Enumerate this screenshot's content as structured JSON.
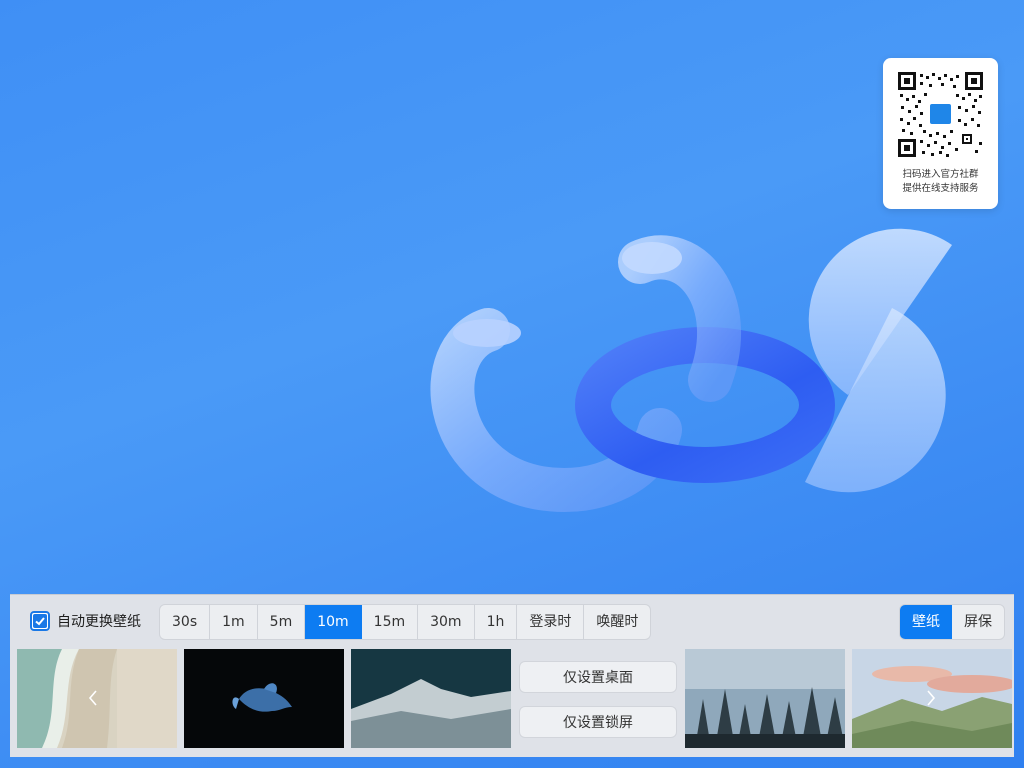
{
  "qr_card": {
    "line1": "扫码进入官方社群",
    "line2": "提供在线支持服务"
  },
  "panel": {
    "auto_change": {
      "label": "自动更换壁纸",
      "checked": true
    },
    "intervals": [
      {
        "label": "30s",
        "active": false
      },
      {
        "label": "1m",
        "active": false
      },
      {
        "label": "5m",
        "active": false
      },
      {
        "label": "10m",
        "active": true
      },
      {
        "label": "15m",
        "active": false
      },
      {
        "label": "30m",
        "active": false
      },
      {
        "label": "1h",
        "active": false
      },
      {
        "label": "登录时",
        "active": false
      },
      {
        "label": "唤醒时",
        "active": false
      }
    ],
    "mode": {
      "wallpaper": "壁纸",
      "screensaver": "屏保",
      "selected": "壁纸"
    },
    "actions": {
      "set_desktop": "仅设置桌面",
      "set_lockscreen": "仅设置锁屏"
    },
    "thumbnails": [
      {
        "subject": "beach-aerial"
      },
      {
        "subject": "betta-fish-dark"
      },
      {
        "subject": "mountain-mist"
      },
      {
        "subject": "foggy-forest"
      },
      {
        "subject": "mountain-valley-sunset"
      }
    ],
    "nav": {
      "prev_icon": "chevron-left-icon",
      "next_icon": "chevron-right-icon"
    }
  },
  "colors": {
    "accent": "#0d7cf2",
    "panel_bg": "#dfe2e8",
    "desktop_bg": "#3f8ff5"
  }
}
